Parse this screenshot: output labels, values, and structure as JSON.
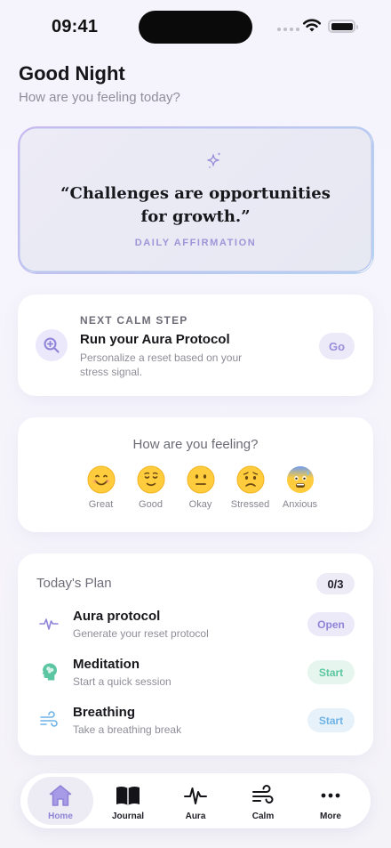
{
  "status": {
    "time": "09:41"
  },
  "greeting": {
    "title": "Good Night",
    "subtitle": "How are you feeling today?"
  },
  "affirmation": {
    "quote": "“Challenges are opportunities for growth.”",
    "label": "DAILY AFFIRMATION",
    "icon": "sparkles-icon"
  },
  "next_step": {
    "eyebrow": "NEXT CALM STEP",
    "title": "Run your Aura Protocol",
    "description": "Personalize a reset based on your stress signal.",
    "button_label": "Go",
    "icon": "zoom-in-icon"
  },
  "mood": {
    "title": "How are you feeling?",
    "options": [
      {
        "label": "Great",
        "icon": "grinning-face-icon"
      },
      {
        "label": "Good",
        "icon": "relieved-face-icon"
      },
      {
        "label": "Okay",
        "icon": "neutral-face-icon"
      },
      {
        "label": "Stressed",
        "icon": "worried-face-icon"
      },
      {
        "label": "Anxious",
        "icon": "anxious-face-icon"
      }
    ]
  },
  "plan": {
    "title": "Today's Plan",
    "count": "0/3",
    "items": [
      {
        "title": "Aura protocol",
        "description": "Generate your reset protocol",
        "button_label": "Open",
        "icon": "pulse-icon",
        "color": "#8f84d8",
        "button_bg": "#eceaf9"
      },
      {
        "title": "Meditation",
        "description": "Start a quick session",
        "button_label": "Start",
        "icon": "brain-head-icon",
        "color": "#5cc6a2",
        "button_bg": "#e6f6ef"
      },
      {
        "title": "Breathing",
        "description": "Take a breathing break",
        "button_label": "Start",
        "icon": "wind-icon",
        "color": "#6fb3e6",
        "button_bg": "#e6f1fa"
      }
    ]
  },
  "tabs": [
    {
      "label": "Home",
      "icon": "home-icon",
      "active": true
    },
    {
      "label": "Journal",
      "icon": "book-icon",
      "active": false
    },
    {
      "label": "Aura",
      "icon": "pulse-icon",
      "active": false
    },
    {
      "label": "Calm",
      "icon": "wind-icon",
      "active": false
    },
    {
      "label": "More",
      "icon": "more-dots-icon",
      "active": false
    }
  ]
}
